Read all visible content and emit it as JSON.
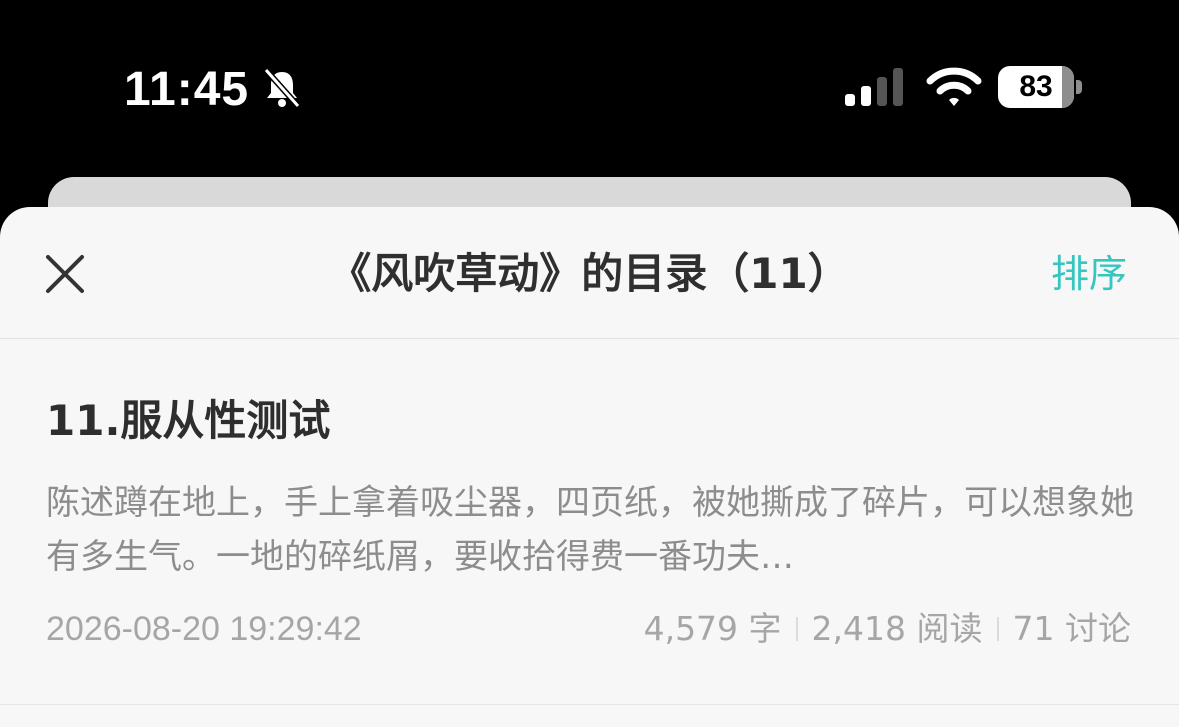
{
  "status_bar": {
    "time": "11:45",
    "battery": "83",
    "battery_level": 0.83,
    "icons": [
      "bell-slash-icon",
      "cellular-signal-icon",
      "wifi-icon",
      "battery-icon"
    ]
  },
  "header": {
    "title": "《风吹草动》的目录（11）",
    "sort_label": "排序",
    "accent_color": "#35c6c0"
  },
  "chapters": [
    {
      "title": "11.服从性测试",
      "excerpt": "陈述蹲在地上，手上拿着吸尘器，四页纸，被她撕成了碎片，可以想象她有多生气。一地的碎纸屑，要收拾得费一番功夫…",
      "date": "2026-08-20 19:29:42",
      "words": "4,579 字",
      "reads": "2,418 阅读",
      "comments": "71 讨论"
    }
  ]
}
